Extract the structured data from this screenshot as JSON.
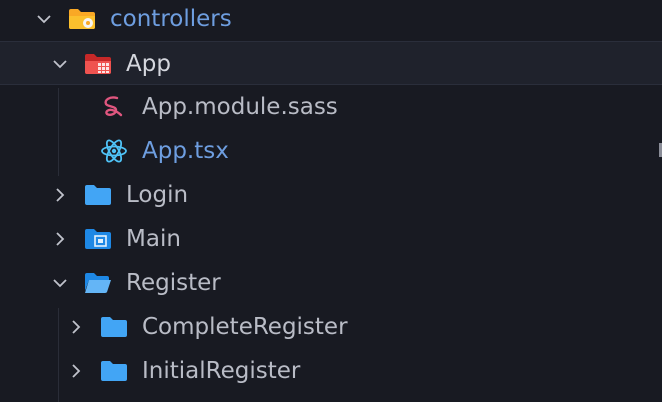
{
  "explorer": {
    "items": [
      {
        "label": "controllers",
        "icon": "folder-config-icon",
        "expanded": true,
        "color": "#6e9ee0"
      },
      {
        "label": "App",
        "icon": "folder-app-icon",
        "expanded": true,
        "selected": true,
        "color": "#d5d7de"
      },
      {
        "label": "App.module.sass",
        "icon": "sass-icon",
        "color": "#b9bcc6"
      },
      {
        "label": "App.tsx",
        "icon": "react-icon",
        "color": "#6e9ee0"
      },
      {
        "label": "Login",
        "icon": "folder-icon",
        "expanded": false,
        "color": "#b9bcc6"
      },
      {
        "label": "Main",
        "icon": "folder-main-icon",
        "expanded": false,
        "color": "#b9bcc6"
      },
      {
        "label": "Register",
        "icon": "folder-open-icon",
        "expanded": true,
        "color": "#b9bcc6"
      },
      {
        "label": "CompleteRegister",
        "icon": "folder-icon",
        "expanded": false,
        "color": "#b9bcc6"
      },
      {
        "label": "InitialRegister",
        "icon": "folder-icon",
        "expanded": false,
        "color": "#b9bcc6"
      }
    ]
  },
  "colors": {
    "background": "#181a22",
    "selected_row": "#1f222c",
    "folder_blue": "#42a5f5",
    "folder_red": "#ef5350",
    "folder_yellow": "#f9a825",
    "sass_pink": "#e0567f",
    "react_blue": "#4fc3f7"
  }
}
